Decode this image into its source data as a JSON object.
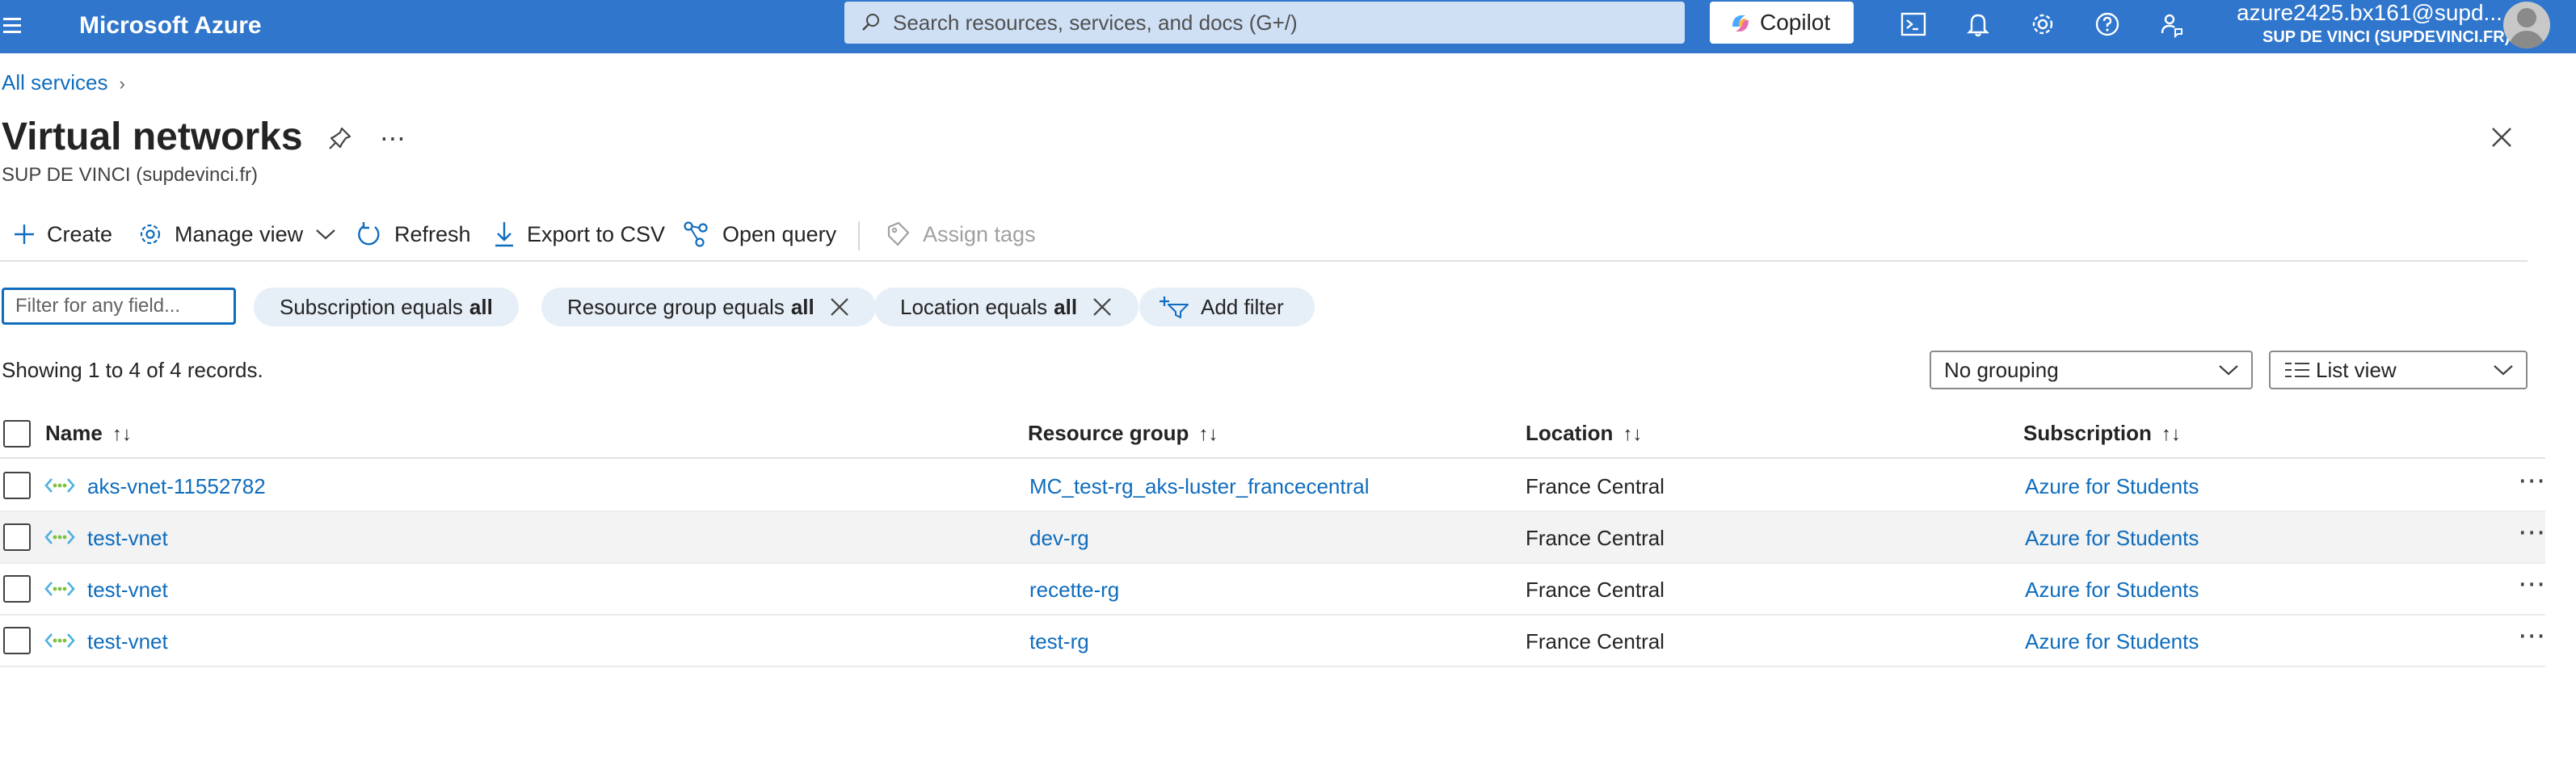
{
  "topbar": {
    "brand": "Microsoft Azure",
    "search_placeholder": "Search resources, services, and docs (G+/)",
    "copilot_label": "Copilot",
    "account_name": "azure2425.bx161@supd...",
    "account_org": "SUP DE VINCI (SUPDEVINCI.FR)",
    "bar_color": "#2f76cc"
  },
  "breadcrumb": {
    "item": "All services"
  },
  "header": {
    "title": "Virtual networks",
    "subtitle": "SUP DE VINCI (supdevinci.fr)"
  },
  "commands": {
    "create": "Create",
    "manage_view": "Manage view",
    "refresh": "Refresh",
    "export_csv": "Export to CSV",
    "open_query": "Open query",
    "assign_tags": "Assign tags"
  },
  "filters": {
    "input_placeholder": "Filter for any field...",
    "subscription": {
      "label": "Subscription equals",
      "value": "all"
    },
    "resource_group": {
      "label": "Resource group equals",
      "value": "all"
    },
    "location": {
      "label": "Location equals",
      "value": "all"
    },
    "add_filter": "Add filter"
  },
  "records_text": "Showing 1 to 4 of 4 records.",
  "grouping": {
    "selected": "No grouping"
  },
  "view_mode": {
    "selected": "List view"
  },
  "table": {
    "columns": [
      "Name",
      "Resource group",
      "Location",
      "Subscription"
    ],
    "rows": [
      {
        "name": "aks-vnet-11552782",
        "resource_group": "MC_test-rg_aks-luster_francecentral",
        "location": "France Central",
        "subscription": "Azure for Students"
      },
      {
        "name": "test-vnet",
        "resource_group": "dev-rg",
        "location": "France Central",
        "subscription": "Azure for Students"
      },
      {
        "name": "test-vnet",
        "resource_group": "recette-rg",
        "location": "France Central",
        "subscription": "Azure for Students"
      },
      {
        "name": "test-vnet",
        "resource_group": "test-rg",
        "location": "France Central",
        "subscription": "Azure for Students"
      }
    ]
  },
  "colors": {
    "link": "#0f6cbd",
    "pill_bg": "#e6eef8",
    "alt_row": "#f3f3f3"
  }
}
